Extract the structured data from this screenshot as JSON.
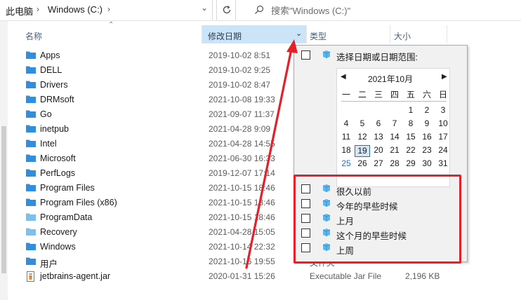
{
  "breadcrumb": {
    "root": "此电脑",
    "drive": "Windows (C:)"
  },
  "search": {
    "placeholder": "搜索\"Windows (C:)\""
  },
  "columns": {
    "name": "名称",
    "date": "修改日期",
    "type": "类型",
    "size": "大小"
  },
  "files": [
    {
      "name": "Apps",
      "date": "2019-10-02 8:51",
      "type": "",
      "size": "",
      "icon": "folder-icon"
    },
    {
      "name": "DELL",
      "date": "2019-10-02 9:25",
      "type": "",
      "size": "",
      "icon": "folder-icon"
    },
    {
      "name": "Drivers",
      "date": "2019-10-02 8:47",
      "type": "",
      "size": "",
      "icon": "folder-icon"
    },
    {
      "name": "DRMsoft",
      "date": "2021-10-08 19:33",
      "type": "",
      "size": "",
      "icon": "folder-icon"
    },
    {
      "name": "Go",
      "date": "2021-09-07 11:37",
      "type": "",
      "size": "",
      "icon": "folder-icon"
    },
    {
      "name": "inetpub",
      "date": "2021-04-28 9:09",
      "type": "",
      "size": "",
      "icon": "folder-icon"
    },
    {
      "name": "Intel",
      "date": "2021-04-28 14:55",
      "type": "",
      "size": "",
      "icon": "folder-icon"
    },
    {
      "name": "Microsoft",
      "date": "2021-06-30 16:33",
      "type": "",
      "size": "",
      "icon": "folder-icon"
    },
    {
      "name": "PerfLogs",
      "date": "2019-12-07 17:14",
      "type": "",
      "size": "",
      "icon": "folder-icon"
    },
    {
      "name": "Program Files",
      "date": "2021-10-15 18:46",
      "type": "",
      "size": "",
      "icon": "folder-icon"
    },
    {
      "name": "Program Files (x86)",
      "date": "2021-10-15 18:46",
      "type": "",
      "size": "",
      "icon": "folder-icon"
    },
    {
      "name": "ProgramData",
      "date": "2021-10-15 18:46",
      "type": "",
      "size": "",
      "icon": "folder-light-icon"
    },
    {
      "name": "Recovery",
      "date": "2021-04-28 15:05",
      "type": "",
      "size": "",
      "icon": "folder-light-icon"
    },
    {
      "name": "Windows",
      "date": "2021-10-14 22:32",
      "type": "",
      "size": "",
      "icon": "folder-icon"
    },
    {
      "name": "用户",
      "date": "2021-10-16 19:55",
      "type": "文件夹",
      "size": "",
      "icon": "folder-icon"
    },
    {
      "name": "jetbrains-agent.jar",
      "date": "2020-01-31 15:26",
      "type": "Executable Jar File",
      "size": "2,196 KB",
      "icon": "jar-file-icon"
    }
  ],
  "date_filter": {
    "range_label": "选择日期或日期范围:",
    "calendar": {
      "title": "2021年10月",
      "weekdays": [
        "一",
        "二",
        "三",
        "四",
        "五",
        "六",
        "日"
      ],
      "weeks": [
        [
          "",
          "",
          "",
          "",
          "1",
          "2",
          "3"
        ],
        [
          "4",
          "5",
          "6",
          "7",
          "8",
          "9",
          "10"
        ],
        [
          "11",
          "12",
          "13",
          "14",
          "15",
          "16",
          "17"
        ],
        [
          "18",
          "19",
          "20",
          "21",
          "22",
          "23",
          "24"
        ],
        [
          "25",
          "26",
          "27",
          "28",
          "29",
          "30",
          "31"
        ]
      ],
      "today": "19",
      "highlight": "25"
    },
    "presets": [
      "很久以前",
      "今年的早些时候",
      "上月",
      "这个月的早些时候",
      "上周"
    ]
  },
  "colors": {
    "annotation": "#e5202a",
    "folder": "#2f8ee0",
    "accent": "#2a6fbf"
  }
}
